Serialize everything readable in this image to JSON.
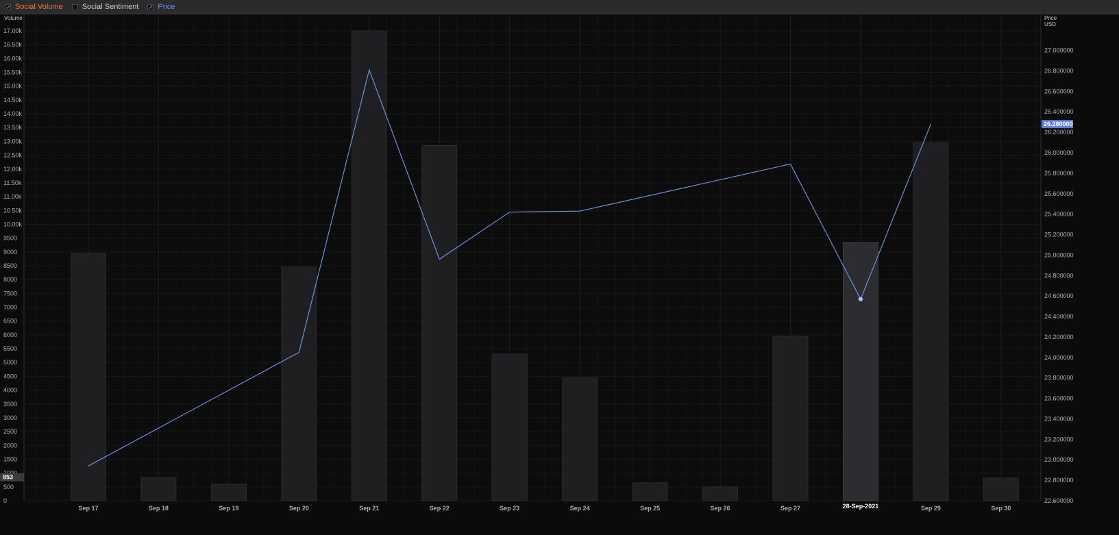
{
  "legend": {
    "items": [
      {
        "label": "Social Volume",
        "color": "#e77a3a",
        "checked": true
      },
      {
        "label": "Social Sentiment",
        "color": "#c9c9cd",
        "checked": false
      },
      {
        "label": "Price",
        "color": "#6f8fe0",
        "checked": true
      }
    ]
  },
  "chart_data": {
    "type": "bar",
    "categories": [
      "Sep 17",
      "Sep 18",
      "Sep 19",
      "Sep 20",
      "Sep 21",
      "Sep 22",
      "Sep 23",
      "Sep 24",
      "Sep 25",
      "Sep 26",
      "Sep 27",
      "Sep 28",
      "Sep 29",
      "Sep 30"
    ],
    "series": [
      {
        "name": "Social Volume",
        "type": "bar",
        "axis": "left",
        "values": [
          8950,
          850,
          600,
          8450,
          17000,
          12850,
          5300,
          4450,
          650,
          500,
          5950,
          9350,
          12950,
          820
        ]
      },
      {
        "name": "Price",
        "type": "line",
        "axis": "right",
        "values": [
          22.94,
          null,
          null,
          24.05,
          26.81,
          24.96,
          25.42,
          25.43,
          null,
          null,
          25.89,
          24.57,
          26.28,
          null
        ]
      }
    ],
    "left_axis": {
      "title": "Volume",
      "min": 0,
      "max": 17000,
      "ticks": [
        "0",
        "500",
        "1000",
        "1500",
        "2000",
        "2500",
        "3000",
        "3500",
        "4000",
        "4500",
        "5000",
        "5500",
        "6000",
        "6500",
        "7000",
        "7500",
        "8000",
        "8500",
        "9000",
        "9500",
        "10.00k",
        "10.50k",
        "11.00k",
        "11.50k",
        "12.00k",
        "12.50k",
        "13.00k",
        "13.50k",
        "14.00k",
        "14.50k",
        "15.00k",
        "15.50k",
        "16.00k",
        "16.50k",
        "17.00k"
      ]
    },
    "right_axis": {
      "title": "Price",
      "subtitle": "USD",
      "min": 22.6,
      "max": 27.0,
      "ticks": [
        "22.600000",
        "22.800000",
        "23.000000",
        "23.200000",
        "23.400000",
        "23.600000",
        "23.800000",
        "24.000000",
        "24.200000",
        "24.400000",
        "24.600000",
        "24.800000",
        "25.000000",
        "25.200000",
        "25.400000",
        "25.600000",
        "25.800000",
        "26.000000",
        "26.200000",
        "26.400000",
        "26.600000",
        "26.800000",
        "27.000000"
      ]
    },
    "crosshair": {
      "category": "Sep 28",
      "date_label": "28-Sep-2021",
      "volume_label": "853",
      "price_label": "26.280000"
    },
    "grid": true,
    "colors": {
      "bar": "#1f1f22",
      "bar_highlight": "#2c2c31",
      "line": "#6f8fe0",
      "price_badge": "#5b7fd6",
      "volume_badge": "#3c3c40"
    }
  }
}
